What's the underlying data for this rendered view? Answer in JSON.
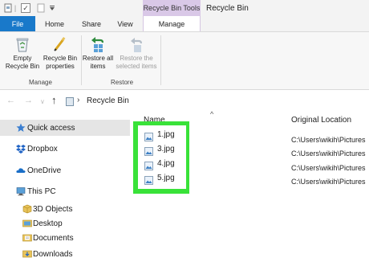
{
  "window": {
    "title": "Recycle Bin",
    "context_tab_header": "Recycle Bin Tools"
  },
  "tabs": [
    {
      "label": "File",
      "active": false
    },
    {
      "label": "Home",
      "active": false
    },
    {
      "label": "Share",
      "active": false
    },
    {
      "label": "View",
      "active": false
    },
    {
      "label": "Manage",
      "active": true
    }
  ],
  "ribbon": {
    "buttons": [
      {
        "label": "Empty Recycle Bin",
        "icon": "recycle-bin-icon",
        "enabled": true
      },
      {
        "label": "Recycle Bin properties",
        "icon": "properties-icon",
        "enabled": true
      },
      {
        "label": "Restore all items",
        "icon": "restore-all-icon",
        "enabled": true
      },
      {
        "label": "Restore the selected items",
        "icon": "restore-selected-icon",
        "enabled": false
      }
    ],
    "groups": [
      {
        "label": "Manage"
      },
      {
        "label": "Restore"
      }
    ]
  },
  "address": {
    "breadcrumb": "Recycle Bin"
  },
  "nav": {
    "items": [
      {
        "label": "Quick access",
        "icon": "star-icon",
        "selected": true
      },
      {
        "label": "Dropbox",
        "icon": "dropbox-icon"
      },
      {
        "label": "OneDrive",
        "icon": "cloud-icon"
      },
      {
        "label": "This PC",
        "icon": "computer-icon"
      },
      {
        "label": "3D Objects",
        "icon": "cube-icon"
      },
      {
        "label": "Desktop",
        "icon": "desktop-icon"
      },
      {
        "label": "Documents",
        "icon": "documents-icon"
      },
      {
        "label": "Downloads",
        "icon": "download-icon"
      }
    ]
  },
  "columns": {
    "name": "Name",
    "original_location": "Original Location"
  },
  "files": [
    {
      "name": "1.jpg",
      "location": "C:\\Users\\wikih\\Pictures"
    },
    {
      "name": "3.jpg",
      "location": "C:\\Users\\wikih\\Pictures"
    },
    {
      "name": "4.jpg",
      "location": "C:\\Users\\wikih\\Pictures"
    },
    {
      "name": "5.jpg",
      "location": "C:\\Users\\wikih\\Pictures"
    }
  ],
  "colors": {
    "file_tab": "#1979ca",
    "context_tab": "#d9c8e7",
    "highlight": "#39e239",
    "selected_nav": "#e5e5e5"
  }
}
